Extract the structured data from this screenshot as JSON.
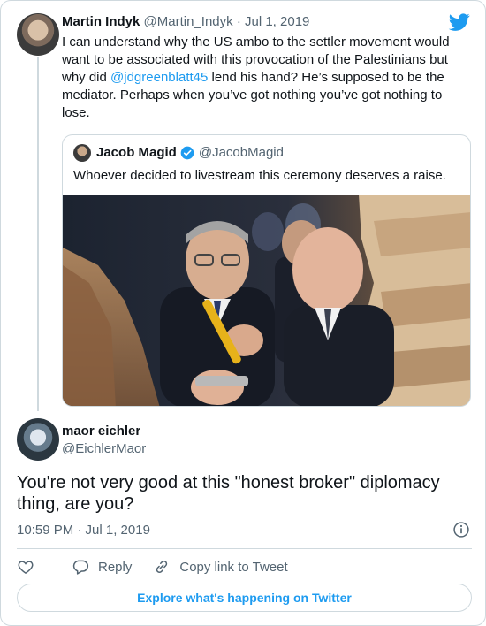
{
  "parent_tweet": {
    "name": "Martin Indyk",
    "handle": "@Martin_Indyk",
    "separator": "·",
    "date": "Jul 1, 2019",
    "text_before": "I can understand why the US ambo to the settler movement would want to be associated with this provocation of the Palestinians but why did ",
    "mention": "@jdgreenblatt45",
    "text_after": " lend his hand? He’s supposed to be the mediator. Perhaps when you’ve got nothing you’ve got nothing to lose."
  },
  "quoted_tweet": {
    "name": "Jacob Magid",
    "handle": "@JacobMagid",
    "text": "Whoever decided to livestream this ceremony deserves a raise."
  },
  "reply_tweet": {
    "name": "maor eichler",
    "handle": "@EichlerMaor",
    "text": "You're not very good at this \"honest broker\" diplomacy thing, are you?",
    "timestamp": "10:59 PM · Jul 1, 2019"
  },
  "actions": {
    "reply_label": "Reply",
    "copy_label": "Copy link to Tweet"
  },
  "footer": {
    "explore_label": "Explore what's happening on Twitter"
  },
  "colors": {
    "link": "#1d9bf0",
    "secondary_text": "#536471",
    "border": "#cfd9de"
  },
  "icons": [
    "twitter-bird-icon",
    "verified-badge-icon",
    "info-icon",
    "heart-icon",
    "reply-icon",
    "copy-link-icon"
  ]
}
